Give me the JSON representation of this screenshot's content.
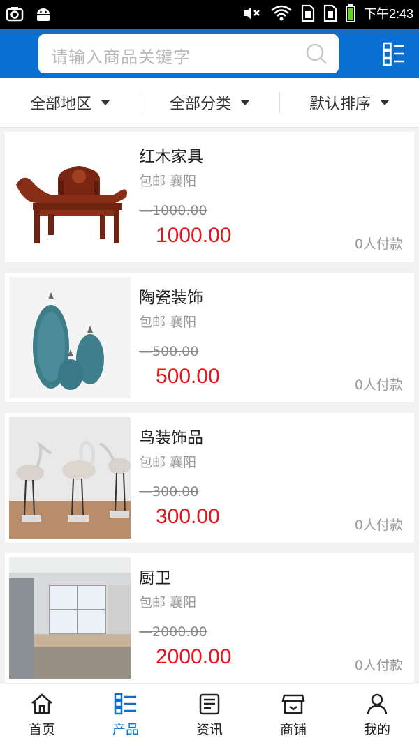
{
  "status_bar": {
    "time": "下午2:43",
    "icons": [
      "screenshot-icon",
      "android-icon",
      "mute-icon",
      "wifi-icon",
      "sim1-icon",
      "sim2-icon",
      "battery-icon"
    ]
  },
  "header": {
    "search_placeholder": "请输入商品关键字",
    "accent_color": "#0a6fd2"
  },
  "filters": [
    {
      "label": "全部地区"
    },
    {
      "label": "全部分类"
    },
    {
      "label": "默认排序"
    }
  ],
  "products": [
    {
      "name": "红木家具",
      "shipping": "包邮",
      "location": "襄阳",
      "original_price": "1000.00",
      "price": "1000.00",
      "sold": "0人付款",
      "image": "rosewood-chair"
    },
    {
      "name": "陶瓷装饰",
      "shipping": "包邮",
      "location": "襄阳",
      "original_price": "500.00",
      "price": "500.00",
      "sold": "0人付款",
      "image": "ceramic-vases"
    },
    {
      "name": "鸟装饰品",
      "shipping": "包邮",
      "location": "襄阳",
      "original_price": "300.00",
      "price": "300.00",
      "sold": "0人付款",
      "image": "bird-figurines"
    },
    {
      "name": "厨卫",
      "shipping": "包邮",
      "location": "襄阳",
      "original_price": "2000.00",
      "price": "2000.00",
      "sold": "0人付款",
      "image": "kitchen"
    }
  ],
  "price_color": "#e8141d",
  "bottom_nav": [
    {
      "label": "首页",
      "icon": "home-icon"
    },
    {
      "label": "产品",
      "icon": "grid-list-icon",
      "active": true
    },
    {
      "label": "资讯",
      "icon": "news-icon"
    },
    {
      "label": "商铺",
      "icon": "store-icon"
    },
    {
      "label": "我的",
      "icon": "user-icon"
    }
  ]
}
